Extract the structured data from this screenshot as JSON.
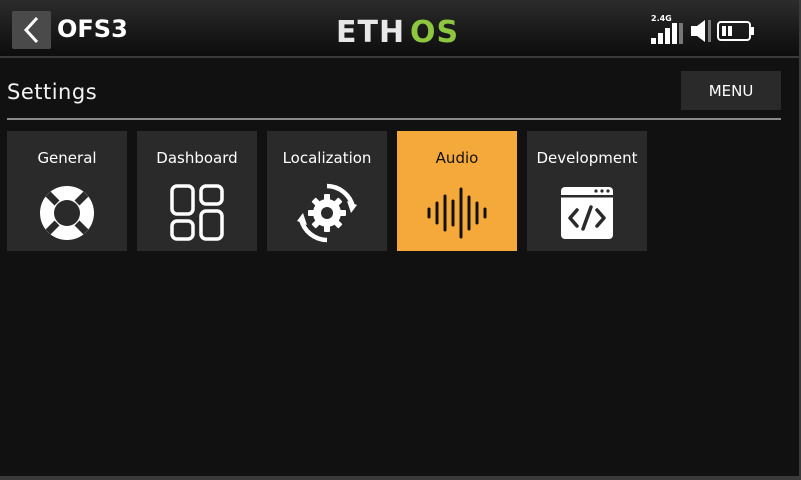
{
  "header": {
    "model_name": "OFS3",
    "logo_text_left": "ETH",
    "logo_text_right": "OS",
    "logo_colors": {
      "left": "#e8e8e8",
      "right": "#8dc63f"
    },
    "status": {
      "band": "2.4G",
      "icons": [
        "signal-bars-icon",
        "speaker-icon",
        "battery-icon"
      ]
    }
  },
  "page": {
    "title": "Settings",
    "menu_label": "MENU"
  },
  "tiles": [
    {
      "label": "General",
      "icon": "lifebuoy-icon",
      "active": false
    },
    {
      "label": "Dashboard",
      "icon": "dashboard-grid-icon",
      "active": false
    },
    {
      "label": "Localization",
      "icon": "gear-refresh-icon",
      "active": false
    },
    {
      "label": "Audio",
      "icon": "sound-wave-icon",
      "active": true
    },
    {
      "label": "Development",
      "icon": "code-window-icon",
      "active": false
    }
  ],
  "colors": {
    "background": "#111111",
    "tile": "#2a2a2a",
    "tile_active": "#f5a93a",
    "accent_green": "#8dc63f"
  }
}
